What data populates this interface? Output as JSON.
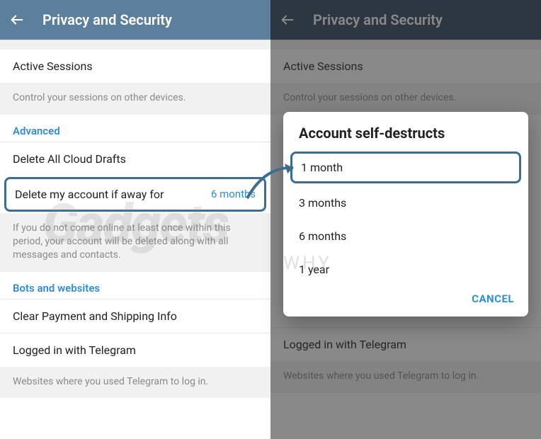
{
  "header_title": "Privacy and Security",
  "left": {
    "active_sessions": "Active Sessions",
    "sessions_hint": "Control your sessions on other devices.",
    "advanced_label": "Advanced",
    "delete_drafts": "Delete All Cloud Drafts",
    "delete_away_label": "Delete my account if away for",
    "delete_away_value": "6 months",
    "away_hint": "If you do not come online at least once within this period, your account will be deleted along with all messages and contacts.",
    "bots_label": "Bots and websites",
    "clear_payment": "Clear Payment and Shipping Info",
    "logged_in": "Logged in with Telegram",
    "logged_in_hint": "Websites where you used Telegram to log in."
  },
  "right": {
    "active_sessions": "Active Sessions",
    "sessions_hint": "Control your sessions on other devices.",
    "logged_in": "Logged in with Telegram",
    "logged_in_hint": "Websites where you used Telegram to log in."
  },
  "dialog": {
    "title": "Account self-destructs",
    "opt1": "1 month",
    "opt2": "3 months",
    "opt3": "6 months",
    "opt4": "1 year",
    "cancel": "CANCEL"
  },
  "watermark": {
    "main": "Gadgets",
    "sub": "WHY"
  }
}
